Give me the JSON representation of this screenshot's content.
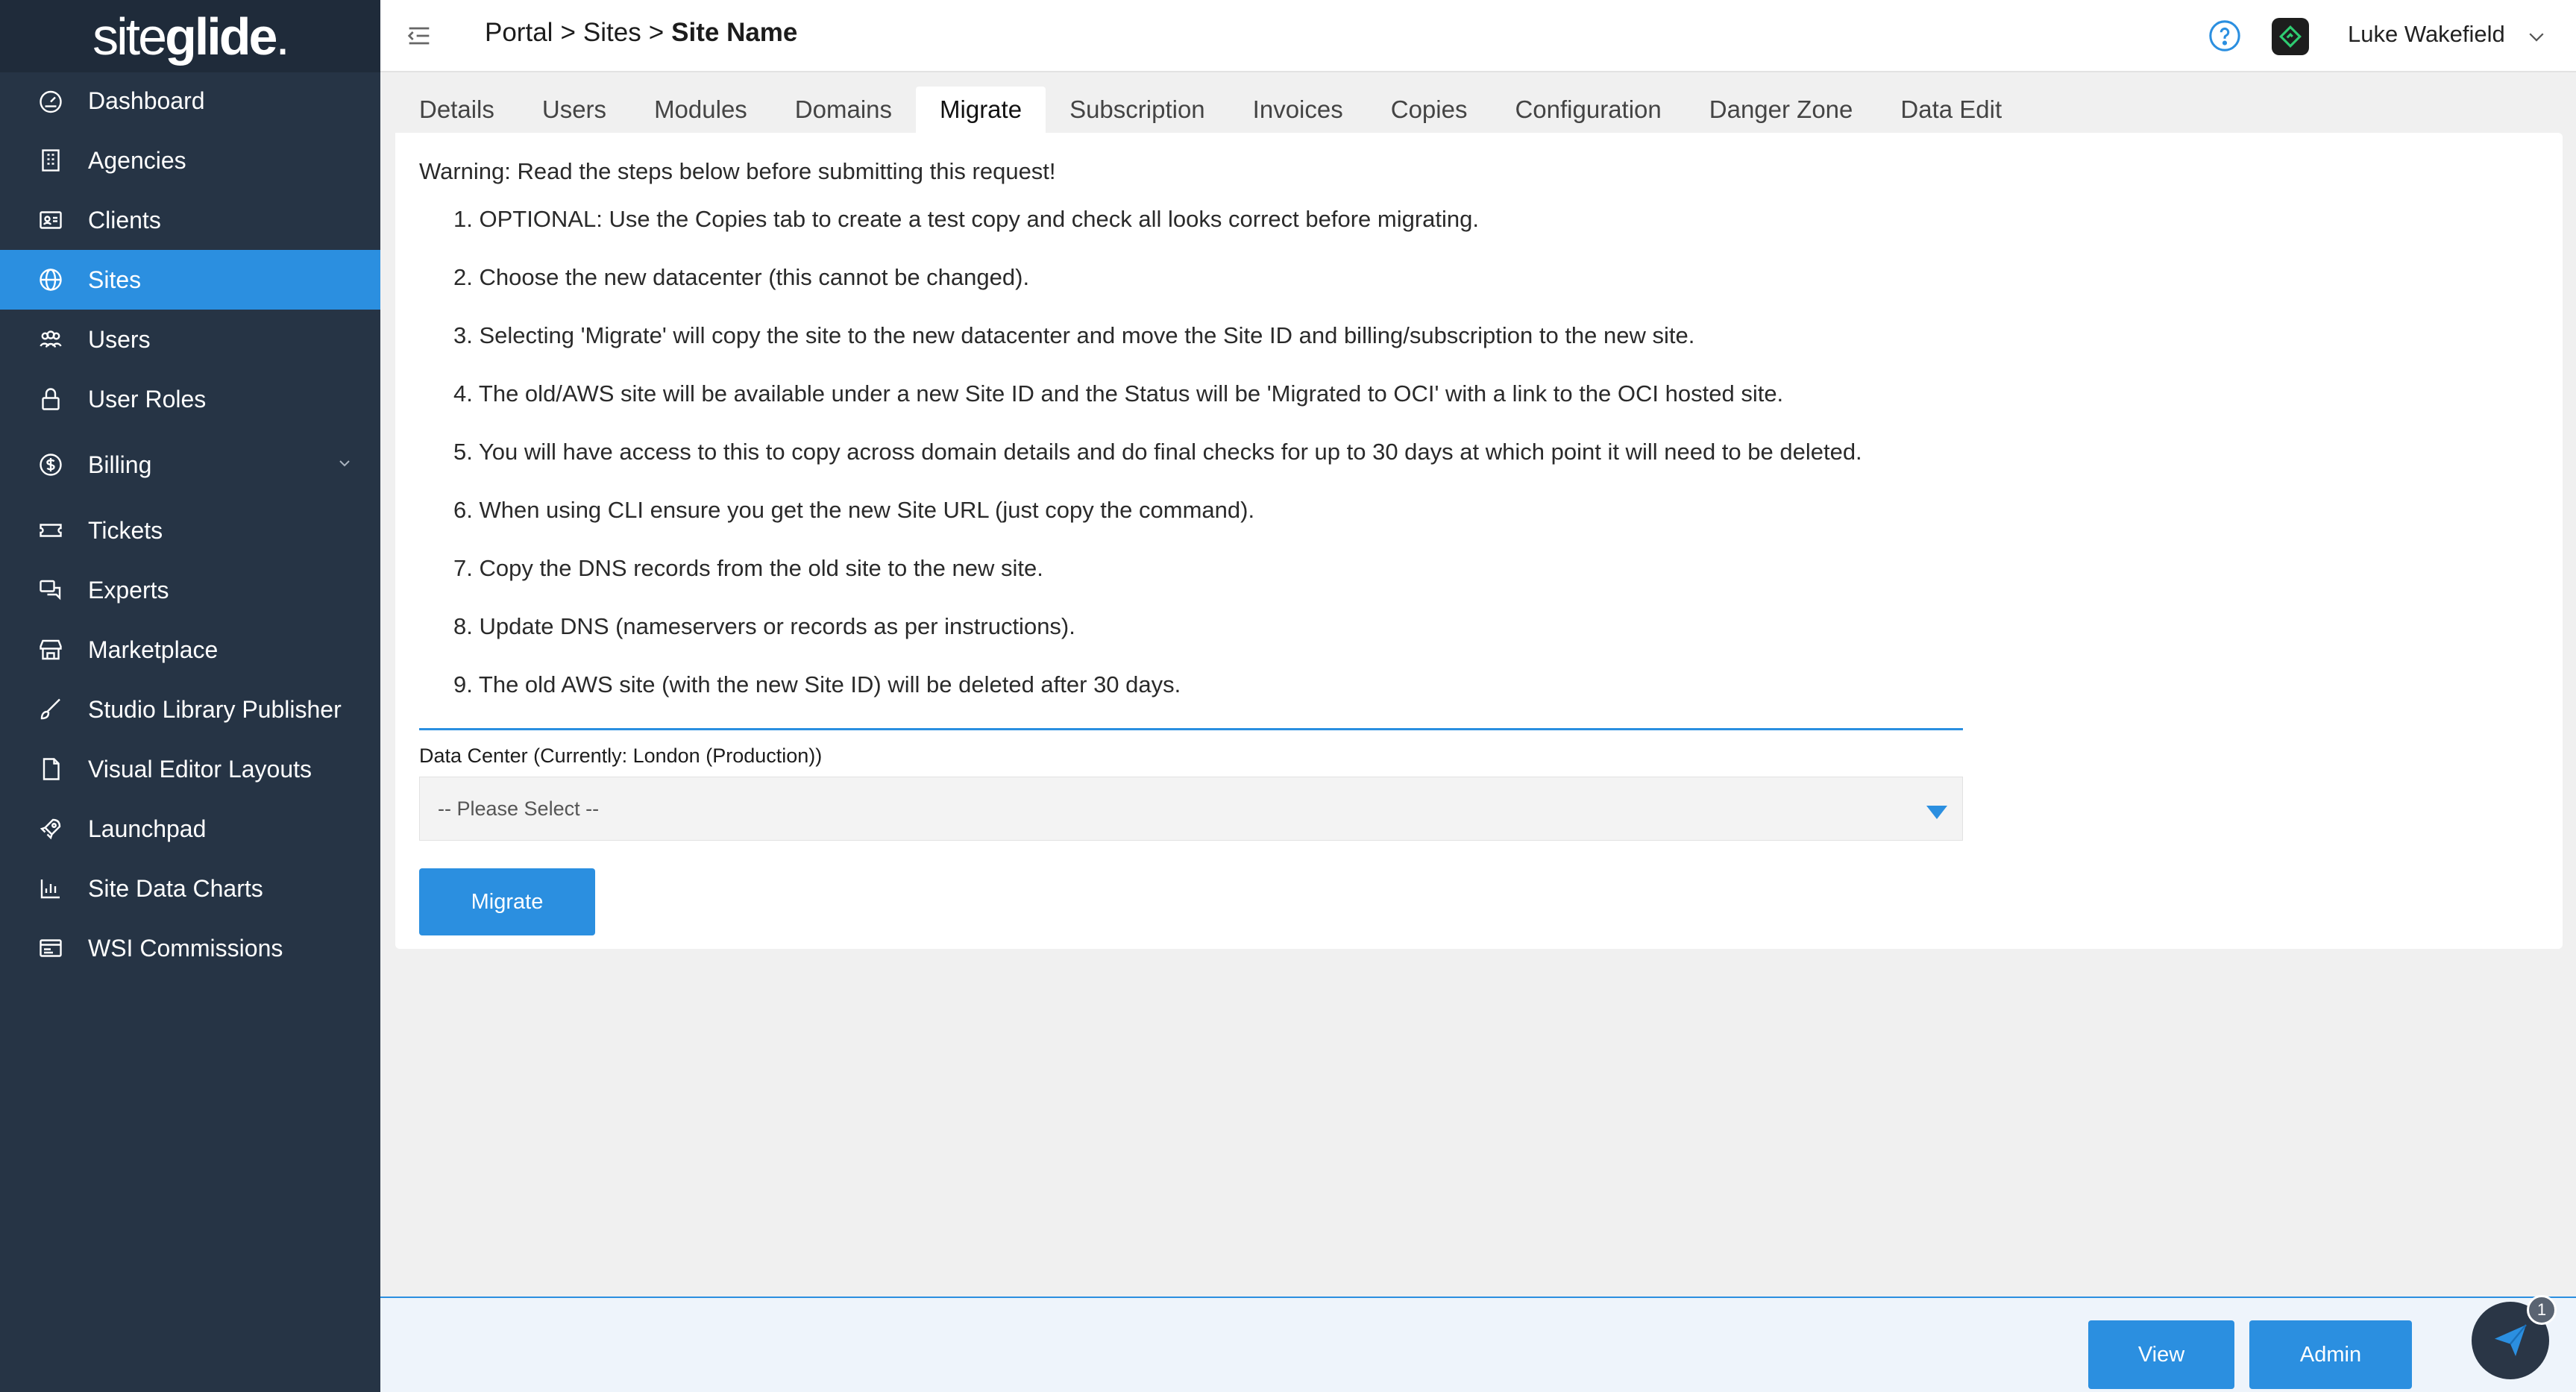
{
  "app": {
    "logo_regular": "site",
    "logo_bold": "glide",
    "logo_dot": "."
  },
  "sidebar": {
    "items": [
      {
        "label": "Dashboard",
        "icon": "speedometer-icon"
      },
      {
        "label": "Agencies",
        "icon": "building-icon"
      },
      {
        "label": "Clients",
        "icon": "contact-card-icon"
      },
      {
        "label": "Sites",
        "icon": "globe-icon",
        "active": true
      },
      {
        "label": "Users",
        "icon": "users-icon"
      },
      {
        "label": "User Roles",
        "icon": "lock-icon"
      },
      {
        "label": "Billing",
        "icon": "dollar-circle-icon",
        "expandable": true
      },
      {
        "label": "Tickets",
        "icon": "ticket-icon"
      },
      {
        "label": "Experts",
        "icon": "chat-bubbles-icon"
      },
      {
        "label": "Marketplace",
        "icon": "store-icon"
      },
      {
        "label": "Studio Library Publisher",
        "icon": "brush-icon"
      },
      {
        "label": "Visual Editor Layouts",
        "icon": "document-icon"
      },
      {
        "label": "Launchpad",
        "icon": "rocket-icon"
      },
      {
        "label": "Site Data Charts",
        "icon": "bar-chart-icon"
      },
      {
        "label": "WSI Commissions",
        "icon": "list-card-icon"
      }
    ]
  },
  "header": {
    "breadcrumb": {
      "portal": "Portal",
      "sep1": ">",
      "sites": "Sites",
      "sep2": ">",
      "current": "Site Name"
    },
    "user_name": "Luke Wakefield"
  },
  "tabs": [
    {
      "label": "Details"
    },
    {
      "label": "Users"
    },
    {
      "label": "Modules"
    },
    {
      "label": "Domains"
    },
    {
      "label": "Migrate",
      "active": true
    },
    {
      "label": "Subscription"
    },
    {
      "label": "Invoices"
    },
    {
      "label": "Copies"
    },
    {
      "label": "Configuration"
    },
    {
      "label": "Danger Zone"
    },
    {
      "label": "Data Edit"
    }
  ],
  "migrate": {
    "warning": "Warning: Read the steps below before submitting this request!",
    "steps": [
      "1. OPTIONAL: Use the Copies tab to create a test copy and check all looks correct before migrating.",
      "2. Choose the new datacenter (this cannot be changed).",
      "3. Selecting 'Migrate' will copy the site to the new datacenter and move the Site ID and billing/subscription to the new site.",
      "4. The old/AWS site will be available under a new Site ID and the Status will be 'Migrated to OCI' with a link to the OCI hosted site.",
      "5. You will have access to this to copy across domain details and do final checks for up to 30 days at which point it will need to be deleted.",
      "6. When using CLI ensure you get the new Site URL (just copy the command).",
      "7. Copy the DNS records from the old site to the new site.",
      "8. Update DNS (nameservers or records as per instructions).",
      "9. The old AWS site (with the new Site ID) will be deleted after 30 days."
    ],
    "data_center_label": "Data Center (Currently: London (Production))",
    "select_value": "-- Please Select --",
    "migrate_button": "Migrate"
  },
  "footer": {
    "view_button": "View",
    "admin_button": "Admin",
    "chat_badge": "1"
  },
  "colors": {
    "accent": "#2b8fe0",
    "sidebar_bg": "#263445",
    "app_icon_green": "#2ecc71"
  }
}
